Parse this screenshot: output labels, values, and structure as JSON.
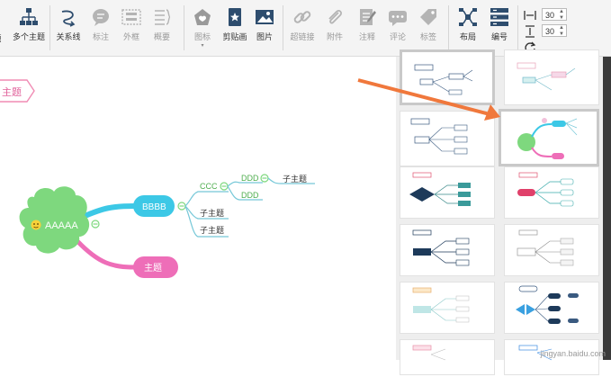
{
  "toolbar": {
    "partial_left": "题",
    "multi_topic": "多个主题",
    "relation": "关系线",
    "label": "标注",
    "outline_box": "外框",
    "summary": "概要",
    "icon": "图标",
    "clipart": "剪贴画",
    "picture": "图片",
    "hyperlink": "超链接",
    "attachment": "附件",
    "note": "注释",
    "comment": "评论",
    "tag": "标签",
    "layout": "布局",
    "numbering": "编号",
    "width_value": "30",
    "height_value": "30"
  },
  "canvas": {
    "partial_topic": "主题",
    "central": "AAAAA",
    "bbbb": "BBBB",
    "ccc": "CCC",
    "ddd1": "DDD",
    "ddd2": "DDD",
    "subtopic1": "子主题",
    "subtopic2": "子主题",
    "subtopic3": "子主题",
    "topic_pink": "主题"
  },
  "watermark": "jingyan.baidu.com",
  "colors": {
    "central_fill": "#7ed87e",
    "bbbb_fill": "#3cc8e6",
    "pink_fill": "#ee6eb8",
    "arrow": "#f0783c",
    "line": "#76c8d8"
  }
}
